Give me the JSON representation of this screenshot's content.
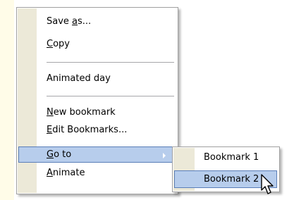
{
  "context_menu": {
    "items": [
      {
        "label": "Save as...",
        "pre": "Save ",
        "mnemonic": "a",
        "post": "s..."
      },
      {
        "label": "Copy",
        "pre": "",
        "mnemonic": "C",
        "post": "opy"
      },
      {
        "label": "Animated day",
        "pre": "Animated day",
        "mnemonic": "",
        "post": ""
      },
      {
        "label": "New bookmark",
        "pre": "",
        "mnemonic": "N",
        "post": "ew bookmark"
      },
      {
        "label": "Edit Bookmarks...",
        "pre": "",
        "mnemonic": "E",
        "post": "dit Bookmarks..."
      },
      {
        "label": "Go to",
        "pre": "",
        "mnemonic": "G",
        "post": "o to",
        "has_submenu": true,
        "highlighted": true
      },
      {
        "label": "Animate",
        "pre": "",
        "mnemonic": "A",
        "post": "nimate"
      }
    ]
  },
  "submenu": {
    "items": [
      {
        "label": "Bookmark 1"
      },
      {
        "label": "Bookmark 2",
        "highlighted": true
      }
    ]
  },
  "colors": {
    "highlight_fill": "#b7cdec",
    "highlight_border": "#5a7eb8",
    "gutter": "#ece9d8",
    "strip": "#fffce8"
  },
  "icons": {
    "submenu_arrow": "chevron-right-icon",
    "cursor": "arrow-cursor-icon"
  }
}
